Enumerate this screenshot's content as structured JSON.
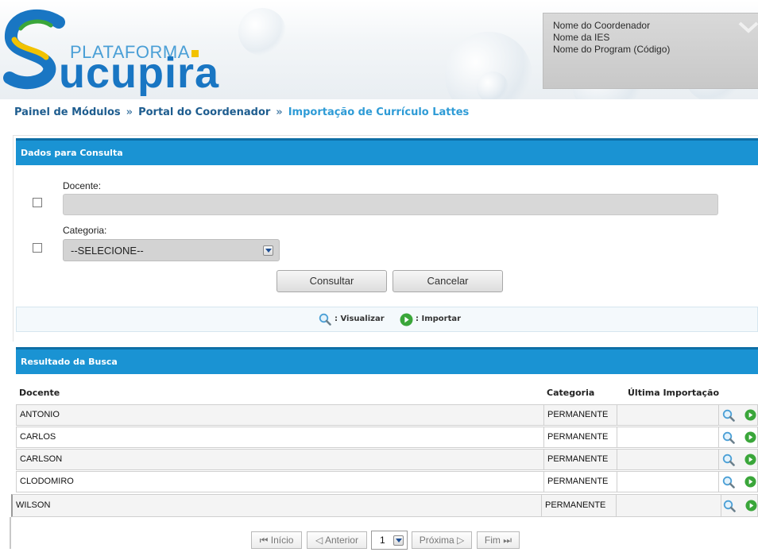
{
  "header": {
    "logo_top": "PLATAFORMA",
    "logo_main": "ucupira",
    "user": {
      "coordenador": "Nome do Coordenador",
      "ies": "Nome da IES",
      "programa": "Nome do Program (Código)"
    }
  },
  "breadcrumb": {
    "items": [
      "Painel de Módulos",
      "Portal do Coordenador",
      "Importação de Currículo Lattes"
    ],
    "separator": "»"
  },
  "search_panel": {
    "title": "Dados para Consulta",
    "docente_label": "Docente:",
    "docente_value": "",
    "categoria_label": "Categoria:",
    "categoria_selected": "--SELECIONE--",
    "consultar_label": "Consultar",
    "cancelar_label": "Cancelar",
    "legend_visualizar": ": Visualizar",
    "legend_importar": ": Importar"
  },
  "results": {
    "title": "Resultado da Busca",
    "columns": {
      "docente": "Docente",
      "categoria": "Categoria",
      "ultima": "Última Importação"
    },
    "rows": [
      {
        "docente": "ANTONIO",
        "categoria": "PERMANENTE",
        "ultima": ""
      },
      {
        "docente": "CARLOS",
        "categoria": "PERMANENTE",
        "ultima": ""
      },
      {
        "docente": "CARLSON",
        "categoria": "PERMANENTE",
        "ultima": ""
      },
      {
        "docente": "CLODOMIRO",
        "categoria": "PERMANENTE",
        "ultima": ""
      },
      {
        "docente": "WILSON",
        "categoria": "PERMANENTE",
        "ultima": ""
      }
    ]
  },
  "pagination": {
    "inicio": "Início",
    "anterior": "Anterior",
    "page": "1",
    "proxima": "Próxima",
    "fim": "Fim"
  },
  "colors": {
    "bar_blue": "#1a93d3",
    "breadcrumb": "#1e5d8f",
    "logo_blue": "#1976c3",
    "icon_green": "#3aa63a"
  }
}
